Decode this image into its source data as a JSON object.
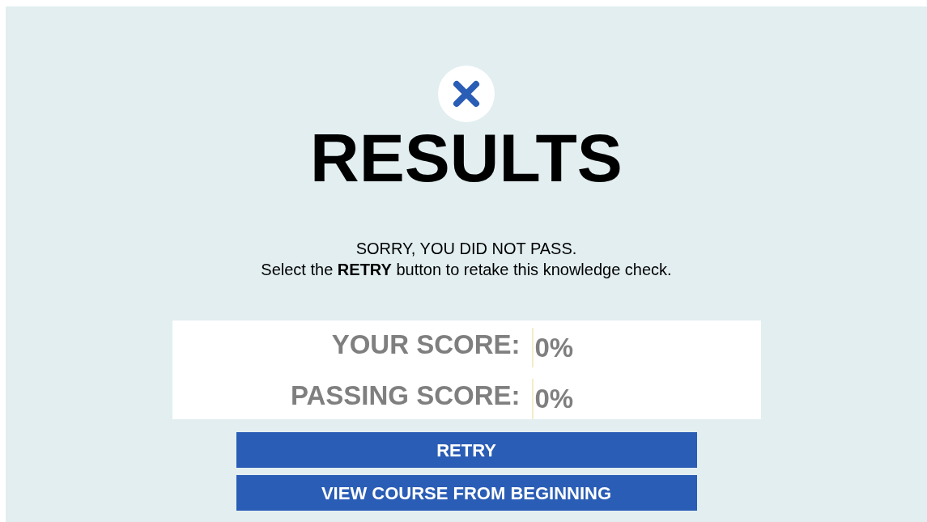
{
  "title": "RESULTS",
  "message": "SORRY, YOU DID NOT PASS.",
  "instruction": "Select the **RETRY** button to retake this knowledge check.",
  "scores": [
    {
      "label": "YOUR SCORE:",
      "value": "0%"
    },
    {
      "label": "PASSING SCORE:",
      "value": "0%"
    }
  ],
  "buttons": [
    "RETRY",
    "VIEW COURSE FROM BEGINNING"
  ]
}
